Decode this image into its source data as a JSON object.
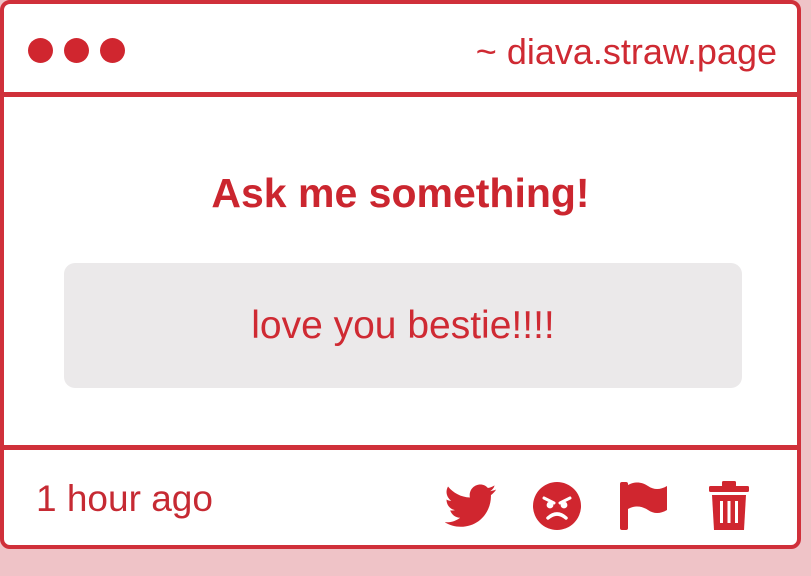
{
  "window": {
    "url": "~ diava.straw.page"
  },
  "question": {
    "heading": "Ask me something!",
    "message": "love you bestie!!!!"
  },
  "footer": {
    "timestamp": "1 hour ago",
    "actions": [
      {
        "icon": "twitter-icon"
      },
      {
        "icon": "angry-face-icon"
      },
      {
        "icon": "flag-icon"
      },
      {
        "icon": "trash-icon"
      }
    ]
  },
  "colors": {
    "accent": "#d0303a",
    "message_bg": "#ebe9ea",
    "page_bg": "#efc3c7"
  }
}
